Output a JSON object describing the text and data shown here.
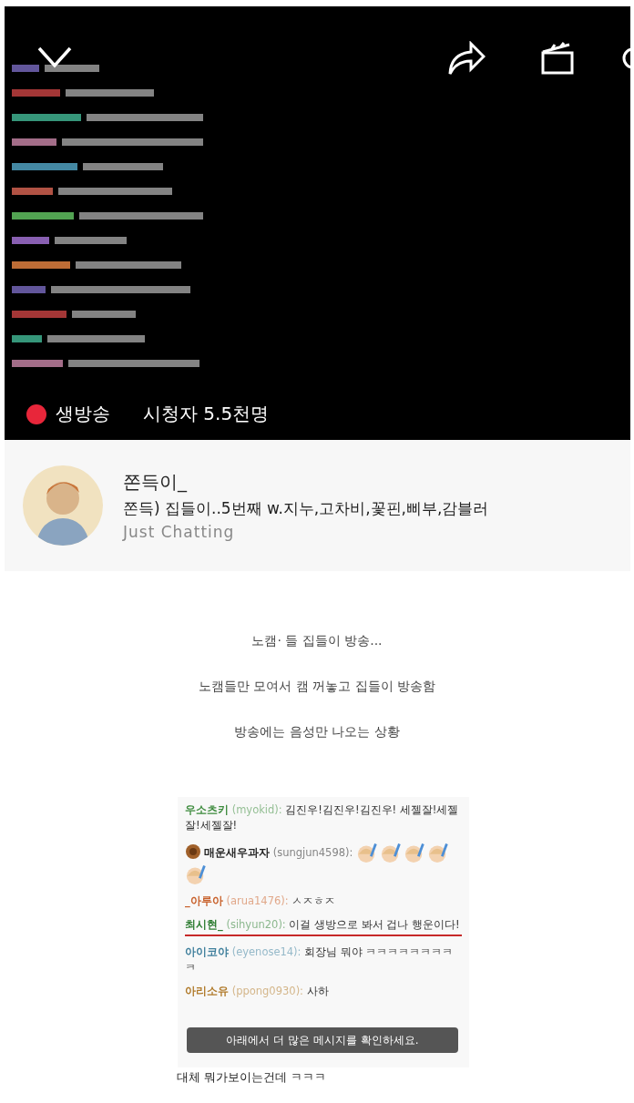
{
  "video": {
    "kind": "picture",
    "live_label": "생방송",
    "viewers": "시청자 5.5천명"
  },
  "channel": {
    "name": "쫀득이_",
    "title": "쫀득) 집들이..5번째 w.지누,고차비,꽃핀,삐부,감블러",
    "category": "Just Chatting"
  },
  "paragraphs": [
    "노캠·  들 집들이 방송...",
    "노캠들만 모여서 캠 꺼놓고 집들이 방송함",
    "방송에는 음성만 나오는 상황"
  ],
  "chat": {
    "rows": [
      {
        "kind": "text",
        "name": "우소츠키",
        "id": "(myokid):",
        "message": "김진우!김진우!김진우! 세젤잘!세젤잘!세젤잘!",
        "color": "#3d8b3d",
        "badge": false,
        "underlined": false
      },
      {
        "kind": "emotes",
        "name": "매운새우과자",
        "id": "(sungjun4598):",
        "color": "#222222",
        "badge": true,
        "underlined": false
      },
      {
        "kind": "text",
        "name": "_아루아",
        "id": "(arua1476):",
        "message": "ㅅㅈㅎㅈ",
        "color": "#c8602a",
        "badge": false,
        "underlined": false
      },
      {
        "kind": "text",
        "name": "최시현_",
        "id": "(sihyun20):",
        "message": "이걸 생방으로 봐서 겁나 행운이다!",
        "color": "#2e7d32",
        "badge": false,
        "underlined": true
      },
      {
        "kind": "text",
        "name": "아이코야",
        "id": "(eyenose14):",
        "message": "회장님 뭐야 ㅋㅋㅋㅋㅋㅋㅋㅋㅋ",
        "color": "#3f7f9c",
        "badge": false,
        "underlined": false
      },
      {
        "kind": "text",
        "name": "아리소유",
        "id": "(ppong0930):",
        "message": "사하",
        "color": "#b07a2a",
        "badge": false,
        "underlined": false
      }
    ],
    "toast": "아래에서 더 많은 메시지를 확인하세요."
  },
  "caption": "대체 뭐가보이는건데 ㅋㅋㅋ"
}
